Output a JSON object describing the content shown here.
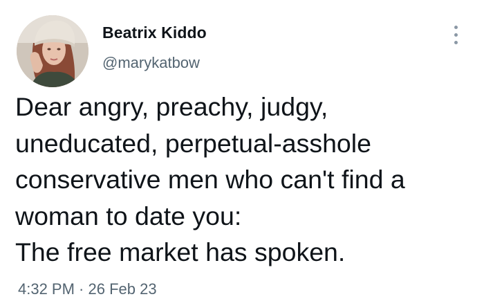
{
  "author": {
    "display_name": "Beatrix Kiddo",
    "handle": "@marykatbow"
  },
  "tweet": {
    "lines": [
      "Dear angry, preachy, judgy,",
      "uneducated, perpetual-asshole",
      "conservative men who can't find a",
      "woman to date you:",
      "The free market has spoken."
    ],
    "timestamp": "4:32 PM · 26 Feb 23"
  },
  "icons": {
    "more": "more-options-icon",
    "avatar": "profile-photo"
  },
  "colors": {
    "text_primary": "#0f1419",
    "text_secondary": "#536471",
    "dots": "#8b98a5"
  }
}
